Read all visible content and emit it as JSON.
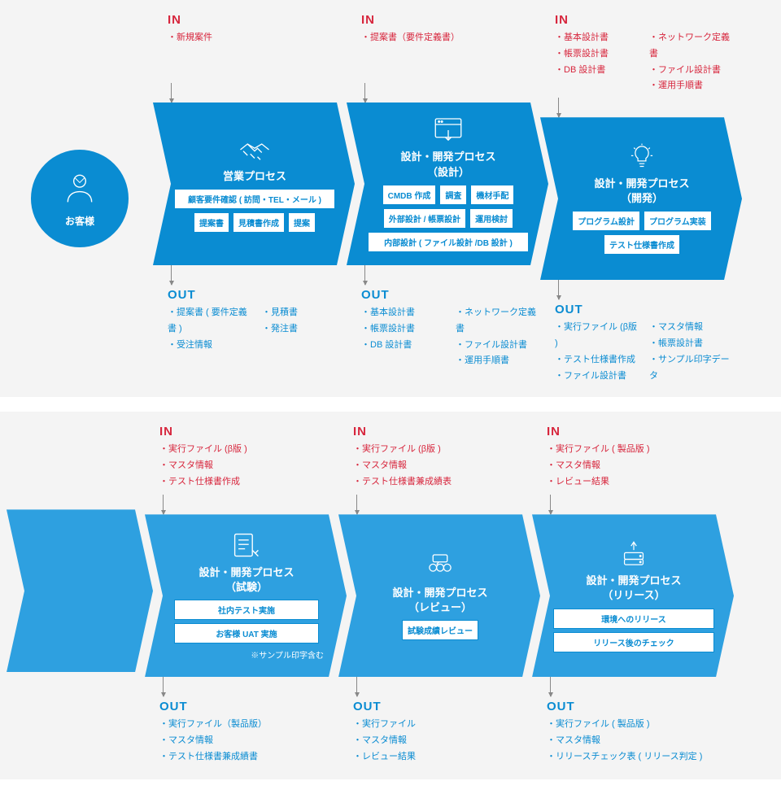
{
  "labels": {
    "in": "IN",
    "out": "OUT"
  },
  "customer_label": "お客様",
  "stages": [
    {
      "title": "営業プロセス",
      "in": {
        "cols": [
          [
            "新規案件"
          ]
        ]
      },
      "tasks": [
        "顧客要件確認 ( 訪問・TEL・メール )",
        "提案書",
        "見積書作成",
        "提案"
      ],
      "task_layout": "wide-first",
      "out": {
        "cols": [
          [
            "提案書 ( 要件定義書 )",
            "受注情報"
          ],
          [
            "見積書",
            "発注書"
          ]
        ]
      }
    },
    {
      "title": "設計・開発プロセス\n（設計）",
      "in": {
        "cols": [
          [
            "提案書（要件定義書）"
          ]
        ]
      },
      "tasks": [
        "CMDB 作成",
        "調査",
        "機材手配",
        "外部設計 / 帳票設計",
        "運用検討",
        "内部設計 ( ファイル設計 /DB 設計 )"
      ],
      "task_layout": "row3-row2-row1",
      "out": {
        "cols": [
          [
            "基本設計書",
            "帳票設計書",
            "DB 設計書"
          ],
          [
            "ネットワーク定義書",
            "ファイル設計書",
            "運用手順書"
          ]
        ]
      }
    },
    {
      "title": "設計・開発プロセス\n（開発）",
      "in": {
        "cols": [
          [
            "基本設計書",
            "帳票設計書",
            "DB 設計書"
          ],
          [
            "ネットワーク定義書",
            "ファイル設計書",
            "運用手順書"
          ]
        ]
      },
      "tasks": [
        "プログラム設計",
        "プログラム実装",
        "テスト仕様書作成"
      ],
      "task_layout": "row2-row1",
      "out": {
        "cols": [
          [
            "実行ファイル (β版 )",
            "テスト仕様書作成",
            "ファイル設計書"
          ],
          [
            "マスタ情報",
            "帳票設計書",
            "サンプル印字データ"
          ]
        ]
      }
    },
    {
      "title": "設計・開発プロセス\n（試験）",
      "in": {
        "cols": [
          [
            "実行ファイル (β版 )",
            "マスタ情報",
            "テスト仕様書作成"
          ]
        ]
      },
      "tasks": [
        "社内テスト実施",
        "お客様 UAT 実施"
      ],
      "task_layout": "stack",
      "note": "※サンプル印字含む",
      "out": {
        "cols": [
          [
            "実行ファイル（製品版）",
            "マスタ情報",
            "テスト仕様書兼成績書"
          ]
        ]
      }
    },
    {
      "title": "設計・開発プロセス\n（レビュー）",
      "in": {
        "cols": [
          [
            "実行ファイル (β版 )",
            "マスタ情報",
            "テスト仕様書兼成績表"
          ]
        ]
      },
      "tasks": [
        "試験成績レビュー"
      ],
      "task_layout": "stack",
      "out": {
        "cols": [
          [
            "実行ファイル",
            "マスタ情報",
            "レビュー結果"
          ]
        ]
      }
    },
    {
      "title": "設計・開発プロセス\n（リリース）",
      "in": {
        "cols": [
          [
            "実行ファイル ( 製品版 )",
            "マスタ情報",
            "レビュー結果"
          ]
        ]
      },
      "tasks": [
        "環境へのリリース",
        "リリース後のチェック"
      ],
      "task_layout": "stack",
      "out": {
        "cols": [
          [
            "実行ファイル ( 製品版 )",
            "マスタ情報",
            "リリースチェック表 ( リリース判定 )"
          ]
        ]
      }
    }
  ],
  "icons": [
    "handshake",
    "browser-touch",
    "bulb",
    "checklist",
    "review",
    "release"
  ]
}
